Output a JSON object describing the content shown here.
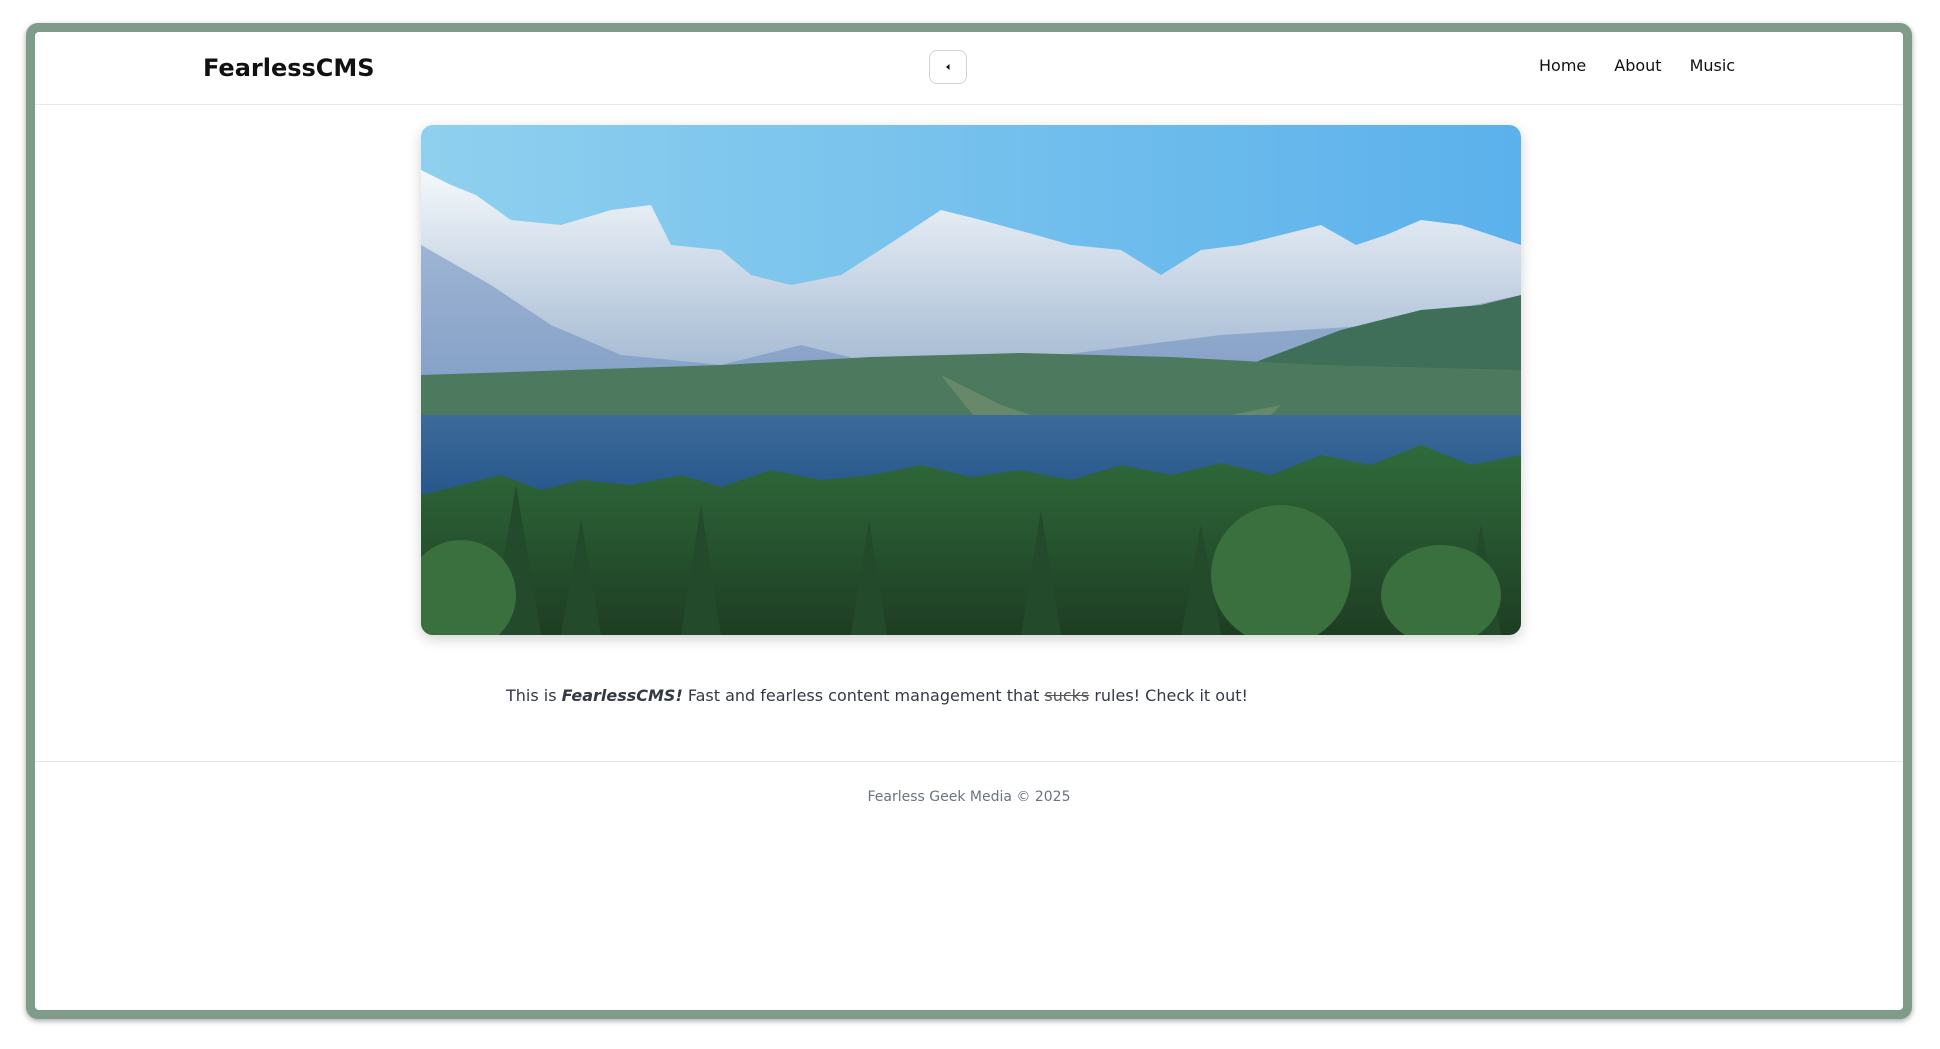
{
  "header": {
    "brand": "FearlessCMS",
    "collapse_icon": "chevron-left-icon",
    "nav": [
      "Home",
      "About",
      "Music"
    ]
  },
  "hero": {
    "image": "mountain-forest-landscape"
  },
  "main": {
    "text_before": "This is ",
    "text_emphasis": "FearlessCMS!",
    "text_middle": " Fast and fearless content management that ",
    "text_strike": "sucks",
    "text_after": " rules! Check it out!"
  },
  "footer": {
    "text": "Fearless Geek Media © 2025"
  },
  "colors": {
    "frame": "#7f9c8b",
    "sky_top": "#5bb1ec",
    "forest": "#2e5b35"
  }
}
